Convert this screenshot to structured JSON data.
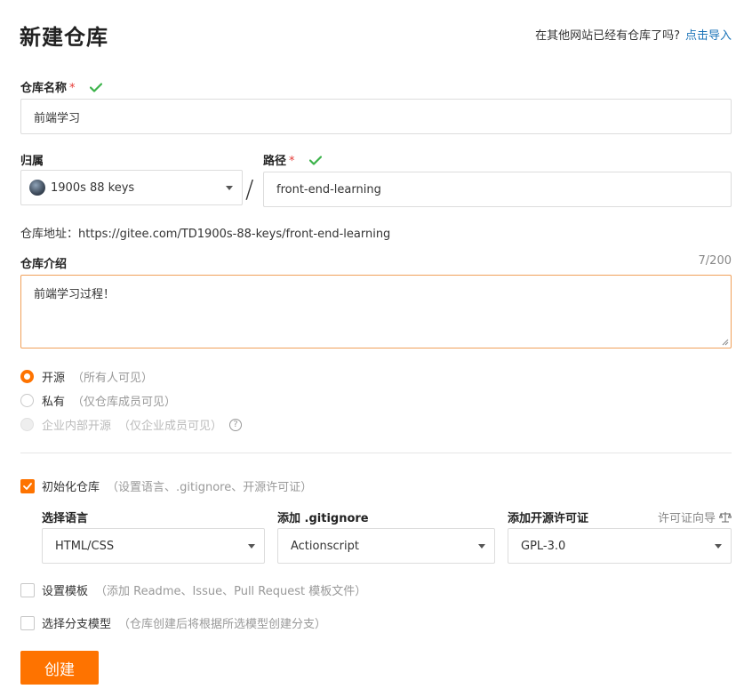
{
  "header": {
    "title": "新建仓库",
    "import_prompt": "在其他网站已经有仓库了吗?",
    "import_link": "点击导入"
  },
  "repo_name": {
    "label": "仓库名称",
    "required_mark": "*",
    "value": "前端学习"
  },
  "owner": {
    "label": "归属",
    "value": "1900s 88 keys"
  },
  "separator": "/",
  "path": {
    "label": "路径",
    "required_mark": "*",
    "value": "front-end-learning"
  },
  "address": {
    "text": "仓库地址：https://gitee.com/TD1900s-88-keys/front-end-learning"
  },
  "description": {
    "label": "仓库介绍",
    "counter": "7/200",
    "value": "前端学习过程！"
  },
  "visibility": {
    "options": [
      {
        "label": "开源",
        "hint": "（所有人可见）",
        "selected": true
      },
      {
        "label": "私有",
        "hint": "（仅仓库成员可见）",
        "selected": false
      },
      {
        "label": "企业内部开源",
        "hint": "（仅企业成员可见）",
        "selected": false,
        "disabled": true
      }
    ],
    "help_icon": "?"
  },
  "init": {
    "label": "初始化仓库",
    "hint": "（设置语言、.gitignore、开源许可证）",
    "checked": true,
    "language_label": "选择语言",
    "language_value": "HTML/CSS",
    "gitignore_label": "添加 .gitignore",
    "gitignore_value": "Actionscript",
    "license_label": "添加开源许可证",
    "license_value": "GPL-3.0",
    "license_guide": "许可证向导"
  },
  "template": {
    "label": "设置模板",
    "hint": "（添加 Readme、Issue、Pull Request 模板文件）",
    "checked": false
  },
  "branch_model": {
    "label": "选择分支模型",
    "hint": "（仓库创建后将根据所选模型创建分支）",
    "checked": false
  },
  "submit": {
    "label": "创建"
  },
  "colors": {
    "accent": "#fe7300",
    "link": "#1a73b8",
    "success": "#3cb34a",
    "required": "#e53935"
  }
}
